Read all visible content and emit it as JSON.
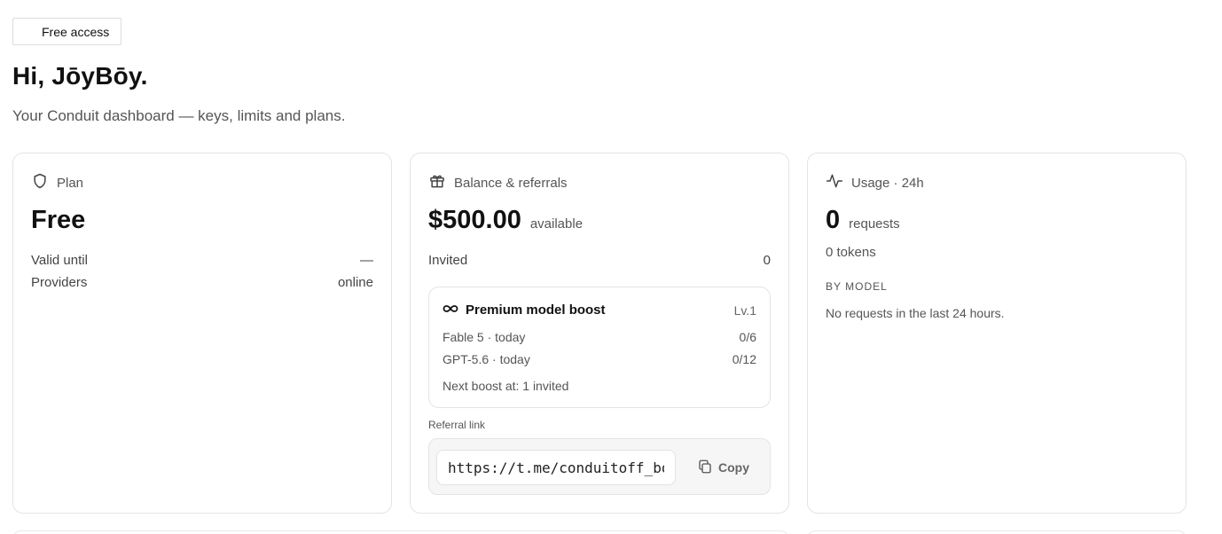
{
  "badge": {
    "label": "Free access"
  },
  "header": {
    "greeting": "Hi, JōyBōy.",
    "subtitle": "Your Conduit dashboard — keys, limits and plans."
  },
  "plan": {
    "title": "Plan",
    "icon": "shield-icon",
    "name": "Free",
    "valid_until_label": "Valid until",
    "valid_until_value": "—",
    "providers_label": "Providers",
    "providers_value": "online"
  },
  "balance": {
    "title": "Balance & referrals",
    "icon": "gift-icon",
    "amount": "$500.00",
    "amount_suffix": "available",
    "invited_label": "Invited",
    "invited_value": "0",
    "boost": {
      "icon": "infinity-icon",
      "title": "Premium model boost",
      "level": "Lv.1",
      "rows": [
        {
          "label": "Fable 5 · today",
          "value": "0/6"
        },
        {
          "label": "GPT-5.6 · today",
          "value": "0/12"
        }
      ],
      "next": "Next boost at: 1 invited"
    },
    "referral": {
      "label": "Referral link",
      "url": "https://t.me/conduitoff_bot",
      "copy_label": "Copy",
      "copy_icon": "copy-icon"
    }
  },
  "usage": {
    "title": "Usage · 24h",
    "icon": "activity-icon",
    "requests": "0",
    "requests_suffix": "requests",
    "tokens": "0 tokens",
    "by_model_label": "BY MODEL",
    "empty_text": "No requests in the last 24 hours."
  }
}
